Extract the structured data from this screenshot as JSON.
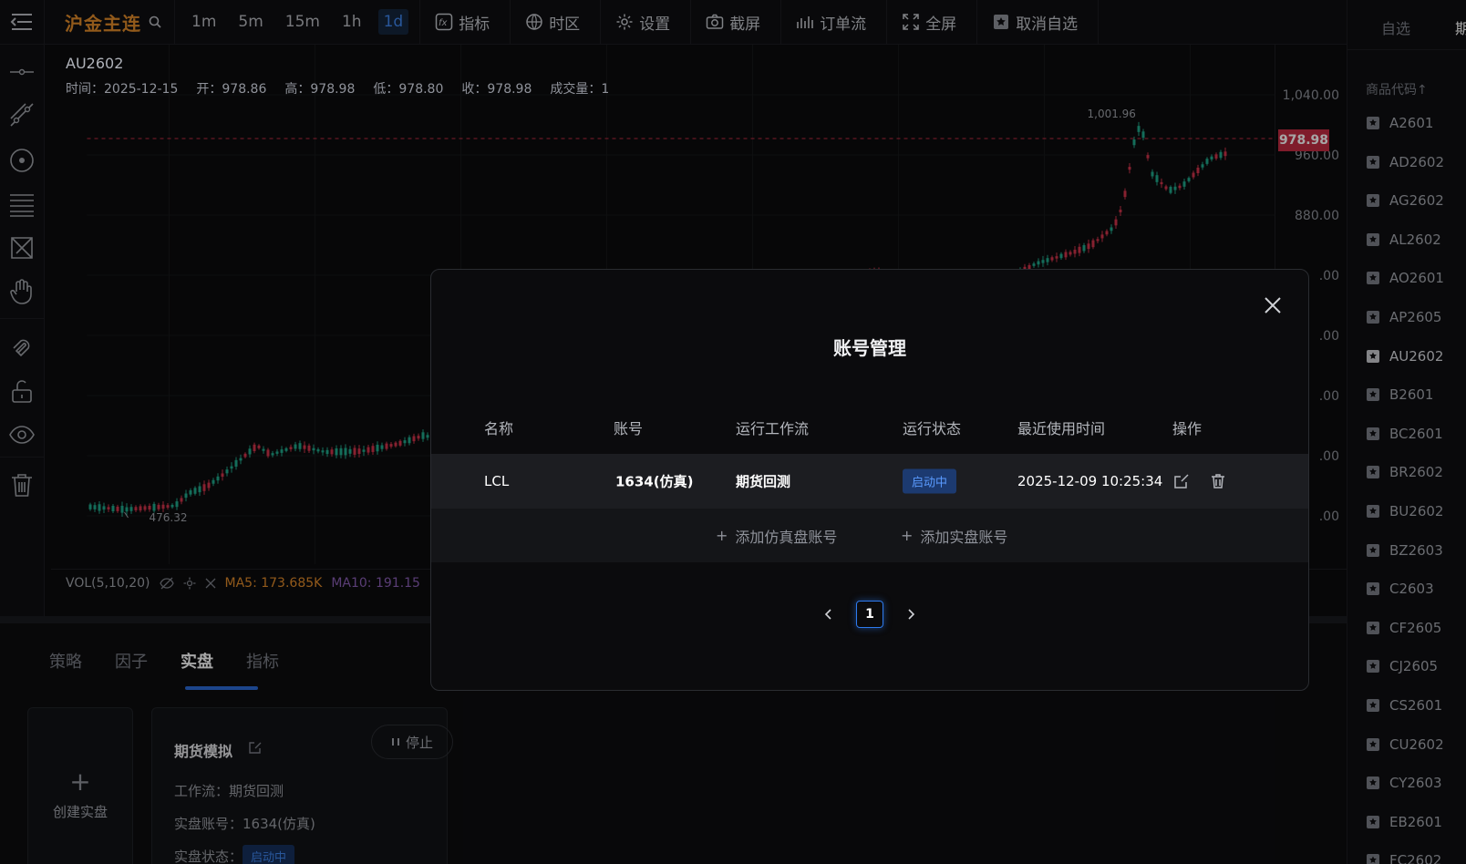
{
  "topbar": {
    "symbol": "沪金主连",
    "intervals": [
      "1m",
      "5m",
      "15m",
      "1h",
      "1d"
    ],
    "active_interval": "1d",
    "tools": {
      "indicator": "指标",
      "timezone": "时区",
      "settings": "设置",
      "screenshot": "截屏",
      "orderflow": "订单流",
      "fullscreen": "全屏",
      "unwatch": "取消自选"
    }
  },
  "chart": {
    "symbol_code": "AU2602",
    "ohlc": {
      "time": "时间：2025-12-15",
      "open": "开：978.86",
      "high": "高：978.98",
      "low": "低：978.80",
      "close": "收：978.98",
      "volume": "成交量：1"
    },
    "price_labels": [
      "1,040.00",
      "960.00",
      "880.00",
      ".00",
      ".00",
      ".00",
      ".00",
      ".00"
    ],
    "last_price": "978.98",
    "high_marker": "1,001.96",
    "low_marker": "476.32",
    "colors": {
      "up": "#d0334a",
      "down": "#1fa88a",
      "last": "#c42b43"
    }
  },
  "volume": {
    "label": "VOL(5,10,20)",
    "ma5": "MA5: 173.685K",
    "ma10": "MA10: 191.15"
  },
  "bottom": {
    "tabs": [
      "策略",
      "因子",
      "实盘",
      "指标"
    ],
    "active_tab": "实盘",
    "create_label": "创建实盘",
    "card": {
      "title": "期货模拟",
      "stop": "停止",
      "workflow": "工作流：期货回测",
      "account": "实盘账号：1634(仿真)",
      "status_label": "实盘状态：",
      "status": "启动中"
    }
  },
  "watchlist": {
    "tabs": [
      "自选",
      "期"
    ],
    "header": "商品代码↑",
    "items": [
      "A2601",
      "AD2602",
      "AG2602",
      "AL2602",
      "AO2601",
      "AP2605",
      "AU2602",
      "B2601",
      "BC2601",
      "BR2602",
      "BU2602",
      "BZ2603",
      "C2603",
      "CF2605",
      "CJ2605",
      "CS2601",
      "CU2602",
      "CY2603",
      "EB2601",
      "FC2602"
    ],
    "current": "AU2602"
  },
  "modal": {
    "title": "账号管理",
    "columns": [
      "名称",
      "账号",
      "运行工作流",
      "运行状态",
      "最近使用时间",
      "操作"
    ],
    "rows": [
      {
        "name": "LCL",
        "account": "1634(仿真)",
        "workflow": "期货回测",
        "status": "启动中",
        "last_used": "2025-12-09 10:25:34"
      }
    ],
    "add_sim": "添加仿真盘账号",
    "add_live": "添加实盘账号",
    "page": "1"
  }
}
